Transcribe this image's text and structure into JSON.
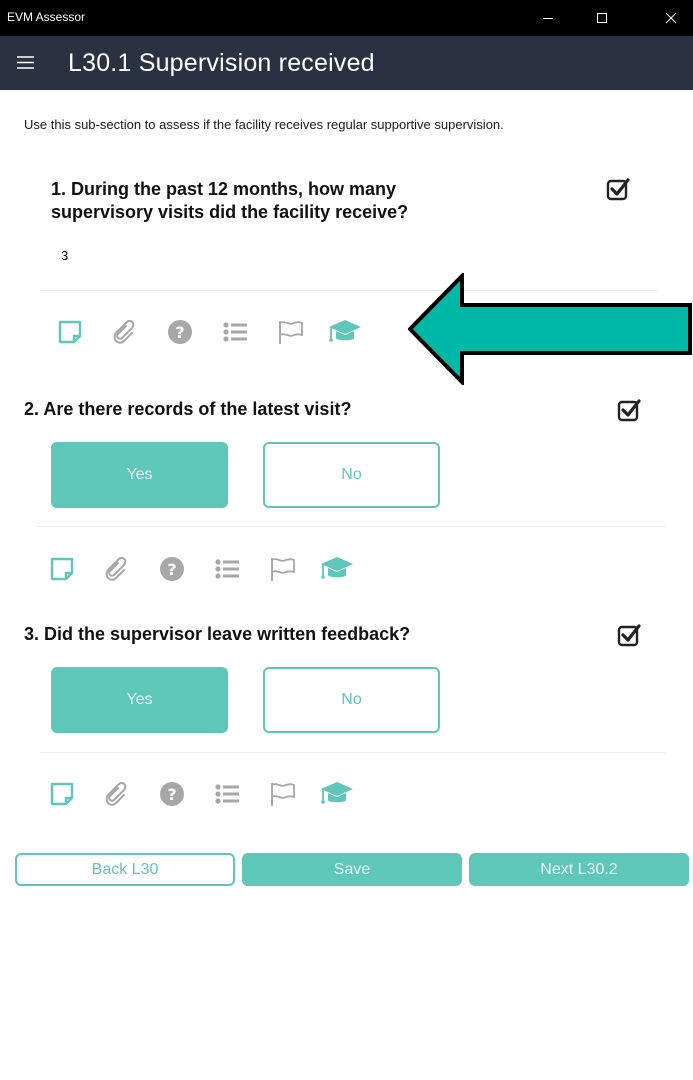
{
  "window": {
    "title": "EVM Assessor"
  },
  "header": {
    "title": "L30.1 Supervision received"
  },
  "intro": "Use this sub-section to assess if the facility receives regular supportive supervision.",
  "questions": [
    {
      "text_line1": "1. During the past 12 months, how many",
      "text_line2": "supervisory visits did the facility receive?",
      "value": "3",
      "checked": true
    },
    {
      "text": "2. Are there records of the latest visit?",
      "yes_label": "Yes",
      "no_label": "No",
      "selected": "Yes",
      "checked": true
    },
    {
      "text": "3. Did the supervisor leave written feedback?",
      "yes_label": "Yes",
      "no_label": "No",
      "selected": "Yes",
      "checked": true
    }
  ],
  "toolbar_icons": [
    "note-icon",
    "attachment-icon",
    "help-icon",
    "list-icon",
    "flag-icon",
    "graduation-cap-icon"
  ],
  "navigation": {
    "back_label": "Back L30",
    "save_label": "Save",
    "next_label": "Next L30.2"
  },
  "colors": {
    "accent": "#5fc7b9",
    "header_bg": "#2a3140",
    "titlebar_bg": "#000000",
    "icon_gray": "#a7a7a7",
    "arrow_fill": "#00b8a6"
  }
}
